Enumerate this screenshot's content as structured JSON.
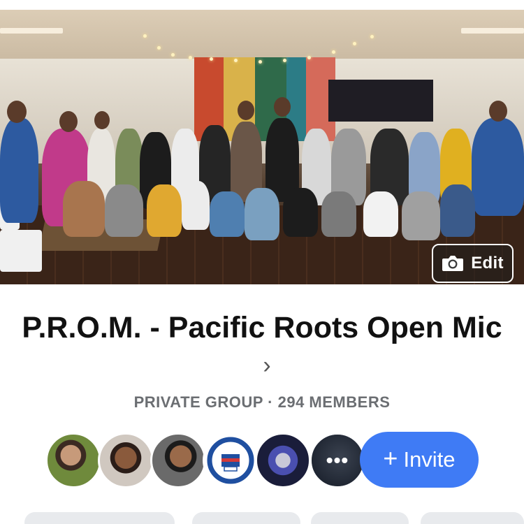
{
  "cover": {
    "edit_label": "Edit"
  },
  "group": {
    "title": "P.R.O.M. - Pacific Roots Open Mic",
    "chevron": "›",
    "subtitle": "PRIVATE GROUP · 294 MEMBERS"
  },
  "members": {
    "more_label": "•••",
    "avatar_colors": [
      "#7a8a4a",
      "#6a5040",
      "#8a5a3c",
      "#1f4fa0",
      "#3a3f8c"
    ],
    "avatar_icons": [
      "member-avatar-1",
      "member-avatar-2",
      "member-avatar-3",
      "member-avatar-4",
      "member-avatar-5"
    ]
  },
  "invite": {
    "plus": "+",
    "label": "Invite",
    "color": "#3f7bf5"
  }
}
